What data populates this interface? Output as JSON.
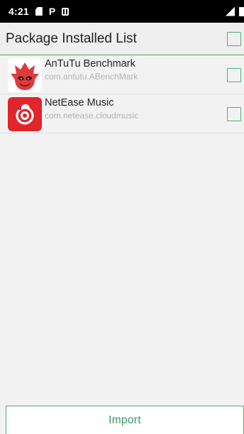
{
  "status_bar": {
    "time": "4:21",
    "p_indicator": "P",
    "icons": [
      "sd-card-icon",
      "p-indicator-icon",
      "app-window-icon",
      "signal-icon",
      "battery-icon"
    ]
  },
  "header": {
    "title": "Package Installed List",
    "select_all_checked": false
  },
  "apps": [
    {
      "name": "AnTuTu Benchmark",
      "package": "com.antutu.ABenchMark",
      "icon": "antutu-icon",
      "checked": false
    },
    {
      "name": "NetEase Music",
      "package": "com.netease.cloudmusic",
      "icon": "netease-music-icon",
      "checked": false
    }
  ],
  "footer": {
    "import_label": "Import"
  },
  "colors": {
    "accent": "#4caf74",
    "status_bar": "#000000",
    "background": "#f2f2f2",
    "antutu_red": "#e03a3e",
    "netease_red": "#e0252b"
  }
}
